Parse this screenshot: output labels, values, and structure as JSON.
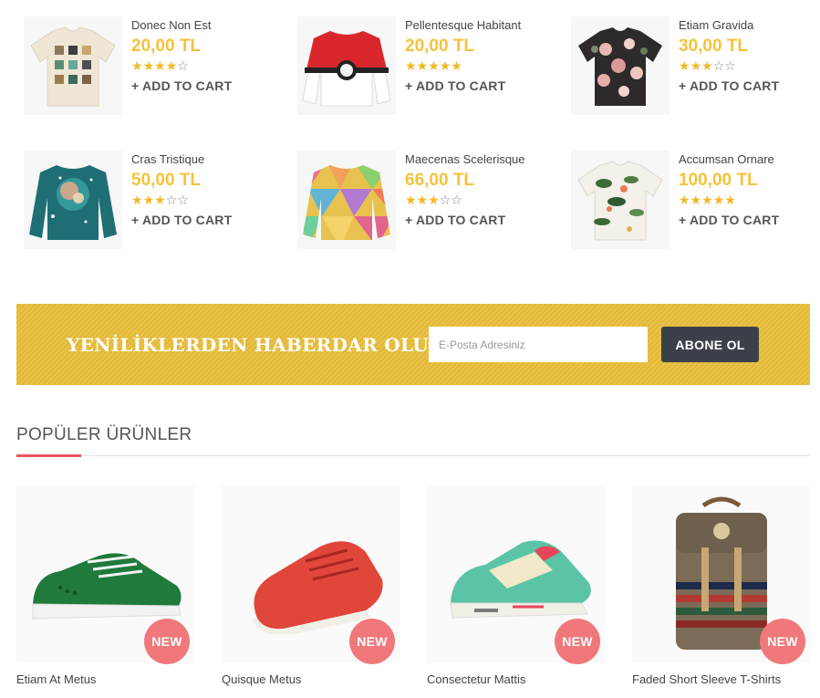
{
  "mini_products": [
    {
      "name": "Donec Non Est",
      "price": "20,00 TL",
      "rating": 4,
      "cart_label": "+ ADD TO CART",
      "image": "tshirt-minerals"
    },
    {
      "name": "Pellentesque Habitant",
      "price": "20,00 TL",
      "rating": 5,
      "cart_label": "+ ADD TO CART",
      "image": "sweater-pokeball"
    },
    {
      "name": "Etiam Gravida",
      "price": "30,00 TL",
      "rating": 3,
      "cart_label": "+ ADD TO CART",
      "image": "tshirt-floral-dark"
    },
    {
      "name": "Cras Tristique",
      "price": "50,00 TL",
      "rating": 3,
      "cart_label": "+ ADD TO CART",
      "image": "sweater-galaxy"
    },
    {
      "name": "Maecenas Scelerisque",
      "price": "66,00 TL",
      "rating": 3,
      "cart_label": "+ ADD TO CART",
      "image": "sweater-geometric"
    },
    {
      "name": "Accumsan Ornare",
      "price": "100,00 TL",
      "rating": 5,
      "cart_label": "+ ADD TO CART",
      "image": "tshirt-floral-light"
    }
  ],
  "newsletter": {
    "title": "YENİLİKLERDEN HABERDAR OLUN!",
    "email_placeholder": "E-Posta Adresiniz",
    "button_label": "ABONE OL"
  },
  "popular": {
    "title": "POPÜLER ÜRÜNLER",
    "badge": "NEW",
    "items": [
      {
        "name": "Etiam At Metus",
        "image": "sneaker-green"
      },
      {
        "name": "Quisque Metus",
        "image": "sneaker-red"
      },
      {
        "name": "Consectetur Mattis",
        "image": "sneaker-mint"
      },
      {
        "name": "Faded Short Sleeve T-Shirts",
        "image": "backpack-striped"
      }
    ]
  },
  "colors": {
    "price": "#f5c33b",
    "star": "#f2b827",
    "newsletter_bg": "#e9be3a",
    "button_dark": "#3c4049",
    "accent": "#e9565b",
    "badge": "#f0787b"
  }
}
